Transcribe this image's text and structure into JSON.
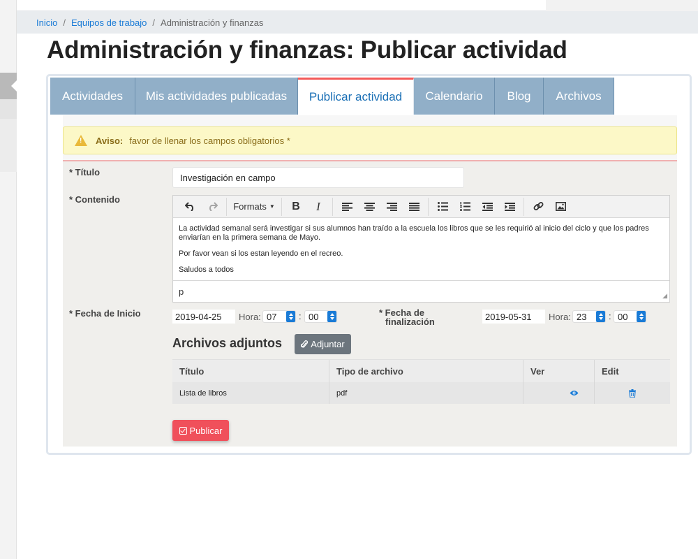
{
  "breadcrumb": {
    "items": [
      "Inicio",
      "Equipos de trabajo"
    ],
    "separator": "/",
    "current": "Administración y finanzas"
  },
  "page_title": "Administración y finanzas: Publicar actividad",
  "tabs": [
    {
      "label": "Actividades",
      "active": false
    },
    {
      "label": "Mis actividades publicadas",
      "active": false
    },
    {
      "label": "Publicar actividad",
      "active": true
    },
    {
      "label": "Calendario",
      "active": false
    },
    {
      "label": "Blog",
      "active": false
    },
    {
      "label": "Archivos",
      "active": false
    }
  ],
  "warning": {
    "title": "Aviso:",
    "message": "favor de llenar los campos obligatorios *",
    "icon": "warning-triangle-icon"
  },
  "form": {
    "title_label": "* Título",
    "title_value": "Investigación en campo",
    "content_label": "* Contenido",
    "toolbar": {
      "formats_label": "Formats",
      "bold_label": "B",
      "italic_label": "I"
    },
    "content_paragraphs": [
      "La actividad semanal será investigar si sus alumnos han traído a la escuela los libros que se les requirió al inicio del ciclo y que los padres enviarían en la primera semana de Mayo.",
      "Por favor vean si los estan leyendo en el recreo.",
      "Saludos a todos"
    ],
    "editor_path": "p",
    "start_label": "* Fecha de Inicio",
    "start_date": "2019-04-25",
    "start_hour_label": "Hora:",
    "start_hour": "07",
    "start_minute": "00",
    "end_label_line1": "* Fecha de",
    "end_label_line2": "finalización",
    "end_date": "2019-05-31",
    "end_hour_label": "Hora:",
    "end_hour": "23",
    "end_minute": "00",
    "time_separator": ":"
  },
  "attachments": {
    "title": "Archivos adjuntos",
    "attach_button": "Adjuntar",
    "columns": [
      "Título",
      "Tipo de archivo",
      "Ver",
      "Edit"
    ],
    "rows": [
      {
        "title": "Lista de libros",
        "type": "pdf"
      }
    ]
  },
  "publish_button": "Publicar",
  "colors": {
    "tab_inactive": "#91afc8",
    "tab_active_border": "#f35a5a",
    "link": "#1a7bd6",
    "publish": "#f0505b",
    "attach": "#6c757d",
    "warning_bg": "#fcf8c7"
  }
}
